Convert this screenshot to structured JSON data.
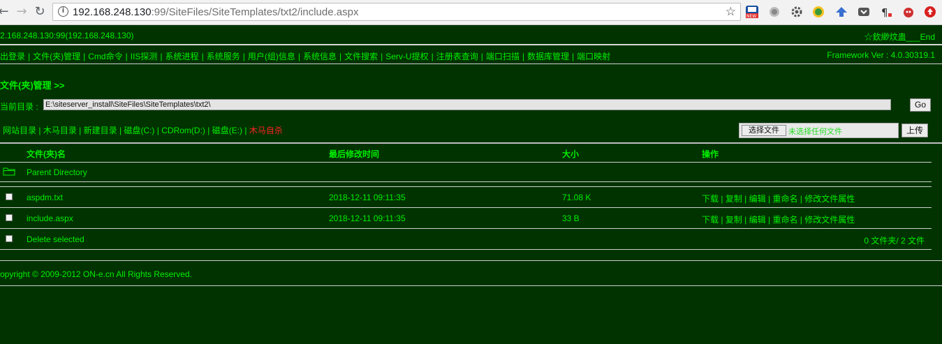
{
  "browser": {
    "back": "←",
    "forward": "→",
    "reload": "↻",
    "url_host": "192.168.248.130",
    "url_rest": ":99/SiteFiles/SiteTemplates/txt2/include.aspx",
    "info_icon": "i",
    "star": "☆",
    "extensions": [
      "news-extension-icon",
      "globe-extension-icon",
      "gear-extension-icon",
      "sync-extension-icon",
      "arrow-extension-icon",
      "pocket-extension-icon",
      "paragraph-extension-icon",
      "devil-extension-icon",
      "download-extension-icon"
    ]
  },
  "header": {
    "host_info": "2.168.248.130:99(192.168.248.130)",
    "user_info": "☆欽緲炆蛊___End",
    "framework": "Framework Ver : 4.0.30319.1"
  },
  "menu": [
    "出登录",
    "文件(夹)管理",
    "Cmd命令",
    "IIS探测",
    "系统进程",
    "系统服务",
    "用户(组)信息",
    "系统信息",
    "文件搜索",
    "Serv-U提权",
    "注册表查询",
    "端口扫描",
    "数据库管理",
    "端口映射"
  ],
  "file_manager": {
    "title": "文件(夹)管理 >>",
    "current_dir_label": "当前目录 :",
    "current_dir_value": "E:\\siteserver_install\\SiteFiles\\SiteTemplates\\txt2\\",
    "go_label": "Go",
    "quick_links": [
      "网站目录",
      "木马目录",
      "新建目录",
      "磁盘(C:)",
      "CDRom(D:)",
      "磁盘(E:)"
    ],
    "self_destruct": "木马自杀",
    "choose_file_label": "选择文件",
    "no_file_text": "未选择任何文件",
    "upload_label": "上传",
    "columns": {
      "name": "文件(夹)名",
      "modified": "最后修改时间",
      "size": "大小",
      "actions": "操作"
    },
    "parent_directory": "Parent Directory",
    "files": [
      {
        "name": "aspdm.txt",
        "modified": "2018-12-11 09:11:35",
        "size": "71.08 K"
      },
      {
        "name": "include.aspx",
        "modified": "2018-12-11 09:11:35",
        "size": "33 B"
      }
    ],
    "file_actions": [
      "下载",
      "复制",
      "编辑",
      "重命名",
      "修改文件属性"
    ],
    "delete_selected": "Delete selected",
    "summary": "0 文件夹/ 2 文件"
  },
  "footer": {
    "copyright": "opyright © 2009-2012 ON-e.cn All Rights Reserved."
  },
  "colors": {
    "background": "#003300",
    "text": "#00ee00",
    "danger": "#ff2222"
  }
}
